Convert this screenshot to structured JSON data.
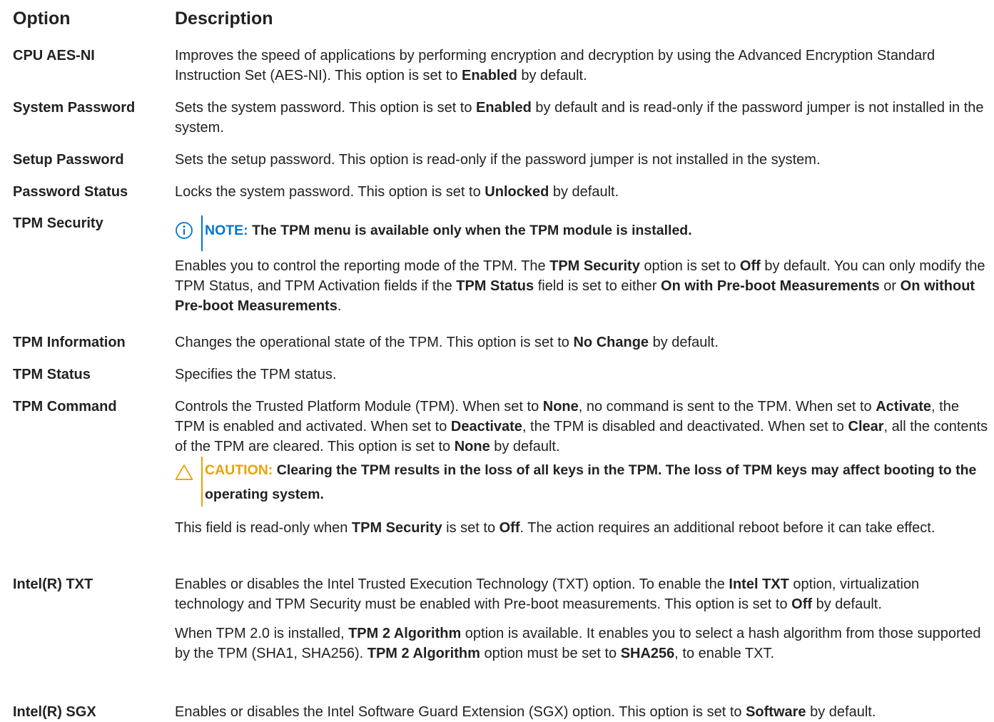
{
  "header": {
    "option": "Option",
    "description": "Description"
  },
  "rows": {
    "cpu_aes_ni": {
      "label": "CPU AES-NI",
      "t1": "Improves the speed of applications by performing encryption and decryption by using the Advanced Encryption Standard Instruction Set (AES-NI). This option is set to ",
      "b1": "Enabled",
      "t2": " by default."
    },
    "system_password": {
      "label": "System Password",
      "t1": "Sets the system password. This option is set to ",
      "b1": "Enabled",
      "t2": " by default and is read-only if the password jumper is not installed in the system."
    },
    "setup_password": {
      "label": "Setup Password",
      "t1": "Sets the setup password. This option is read-only if the password jumper is not installed in the system."
    },
    "password_status": {
      "label": "Password Status",
      "t1": "Locks the system password. This option is set to ",
      "b1": "Unlocked",
      "t2": " by default."
    },
    "tpm_security": {
      "label": "TPM Security",
      "note_key": "NOTE:",
      "note_text": " The TPM menu is available only when the TPM module is installed.",
      "t1": "Enables you to control the reporting mode of the TPM. The ",
      "b1": "TPM Security",
      "t2": " option is set to ",
      "b2": "Off",
      "t3": " by default. You can only modify the TPM Status, and TPM Activation fields if the ",
      "b3": "TPM Status",
      "t4": " field is set to either ",
      "b4": "On with Pre-boot Measurements",
      "t5": " or ",
      "b5": "On without Pre-boot Measurements",
      "t6": "."
    },
    "tpm_information": {
      "label": "TPM Information",
      "t1": "Changes the operational state of the TPM. This option is set to ",
      "b1": "No Change",
      "t2": " by default."
    },
    "tpm_status": {
      "label": "TPM Status",
      "t1": "Specifies the TPM status."
    },
    "tpm_command": {
      "label": "TPM Command",
      "t1": "Controls the Trusted Platform Module (TPM). When set to ",
      "b1": "None",
      "t2": ", no command is sent to the TPM. When set to ",
      "b2": "Activate",
      "t3": ", the TPM is enabled and activated. When set to ",
      "b3": "Deactivate",
      "t4": ", the TPM is disabled and deactivated. When set to ",
      "b4": "Clear",
      "t5": ", all the contents of the TPM are cleared. This option is set to ",
      "b5": "None",
      "t6": " by default.",
      "caution_key": "CAUTION:",
      "caution_text": " Clearing the TPM results in the loss of all keys in the TPM. The loss of TPM keys may affect booting to the operating system.",
      "p2_t1": "This field is read-only when ",
      "p2_b1": "TPM Security",
      "p2_t2": " is set to ",
      "p2_b2": "Off",
      "p2_t3": ". The action requires an additional reboot before it can take effect."
    },
    "intel_txt": {
      "label": "Intel(R) TXT",
      "t1": "Enables or disables the Intel Trusted Execution Technology (TXT) option. To enable the ",
      "b1": "Intel TXT",
      "t2": " option, virtualization technology and TPM Security must be enabled with Pre-boot measurements. This option is set to ",
      "b2": "Off",
      "t3": " by default.",
      "p2_t1": "When TPM 2.0 is installed, ",
      "p2_b1": "TPM 2 Algorithm",
      "p2_t2": " option is available. It enables you to select a hash algorithm from those supported by the TPM (SHA1, SHA256). ",
      "p2_b2": "TPM 2 Algorithm",
      "p2_t3": " option must be set to ",
      "p2_b3": "SHA256",
      "p2_t4": ", to enable TXT."
    },
    "intel_sgx": {
      "label": "Intel(R) SGX",
      "t1": "Enables or disables the Intel Software Guard Extension (SGX) option. This option is set to ",
      "b1": "Software",
      "t2": " by default."
    }
  },
  "icons": {
    "note": "info-circle-icon",
    "caution": "warning-triangle-icon"
  },
  "colors": {
    "note_accent": "#0076ce",
    "caution_accent": "#e8a400",
    "text": "#222222"
  }
}
